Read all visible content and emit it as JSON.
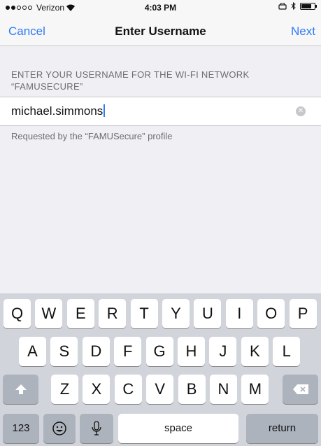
{
  "status_bar": {
    "carrier": "Verizon",
    "time": "4:03 PM"
  },
  "nav": {
    "cancel": "Cancel",
    "title": "Enter Username",
    "next": "Next"
  },
  "form": {
    "header": "ENTER YOUR USERNAME FOR THE WI-FI NETWORK “FAMUSECURE”",
    "value": "michael.simmons",
    "footer": "Requested by the “FAMUSecure” profile"
  },
  "keyboard": {
    "row1": [
      "Q",
      "W",
      "E",
      "R",
      "T",
      "Y",
      "U",
      "I",
      "O",
      "P"
    ],
    "row2": [
      "A",
      "S",
      "D",
      "F",
      "G",
      "H",
      "J",
      "K",
      "L"
    ],
    "row3": [
      "Z",
      "X",
      "C",
      "V",
      "B",
      "N",
      "M"
    ],
    "numbers_label": "123",
    "space_label": "space",
    "return_label": "return"
  }
}
